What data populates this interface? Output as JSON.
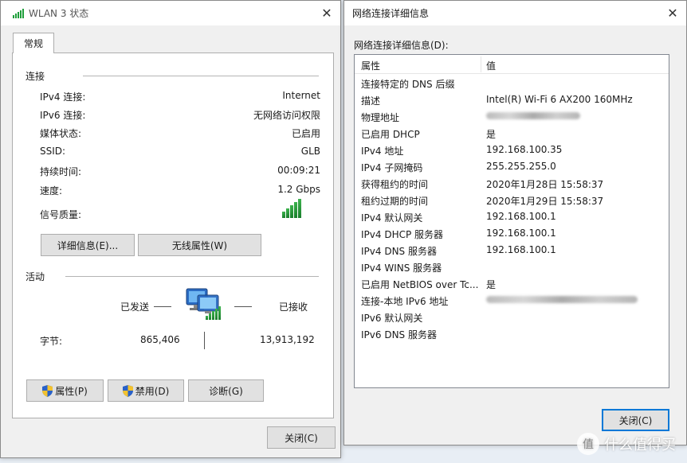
{
  "left": {
    "title": "WLAN 3 状态",
    "tab": "常规",
    "connection_group": "连接",
    "rows": [
      {
        "k": "IPv4 连接:",
        "v": "Internet"
      },
      {
        "k": "IPv6 连接:",
        "v": "无网络访问权限"
      },
      {
        "k": "媒体状态:",
        "v": "已启用"
      },
      {
        "k": "SSID:",
        "v": "GLB"
      },
      {
        "k": "持续时间:",
        "v": "00:09:21"
      },
      {
        "k": "速度:",
        "v": "1.2 Gbps"
      },
      {
        "k": "信号质量:",
        "v": ""
      }
    ],
    "signal_level": "5/5",
    "details_button": "详细信息(E)...",
    "wireless_props_button": "无线属性(W)",
    "activity_group": "活动",
    "sent_label": "已发送",
    "received_label": "已接收",
    "bytes_label": "字节:",
    "bytes_sent": "865,406",
    "bytes_received": "13,913,192",
    "properties_button": "属性(P)",
    "disable_button": "禁用(D)",
    "diagnose_button": "诊断(G)",
    "close_button": "关闭(C)"
  },
  "right": {
    "title": "网络连接详细信息",
    "list_label": "网络连接详细信息(D):",
    "col_property": "属性",
    "col_value": "值",
    "rows": [
      {
        "p": "连接特定的 DNS 后缀",
        "v": ""
      },
      {
        "p": "描述",
        "v": "Intel(R) Wi-Fi 6 AX200 160MHz"
      },
      {
        "p": "物理地址",
        "v": ""
      },
      {
        "p": "已启用 DHCP",
        "v": "是"
      },
      {
        "p": "IPv4 地址",
        "v": "192.168.100.35"
      },
      {
        "p": "IPv4 子网掩码",
        "v": "255.255.255.0"
      },
      {
        "p": "获得租约的时间",
        "v": "2020年1月28日 15:58:37"
      },
      {
        "p": "租约过期的时间",
        "v": "2020年1月29日 15:58:37"
      },
      {
        "p": "IPv4 默认网关",
        "v": "192.168.100.1"
      },
      {
        "p": "IPv4 DHCP 服务器",
        "v": "192.168.100.1"
      },
      {
        "p": "IPv4 DNS 服务器",
        "v": "192.168.100.1"
      },
      {
        "p": "IPv4 WINS 服务器",
        "v": ""
      },
      {
        "p": "已启用 NetBIOS over Tc...",
        "v": "是"
      },
      {
        "p": "连接-本地 IPv6 地址",
        "v": ""
      },
      {
        "p": "IPv6 默认网关",
        "v": ""
      },
      {
        "p": "IPv6 DNS 服务器",
        "v": ""
      }
    ],
    "close_button": "关闭(C)"
  },
  "watermark": "什么值得买",
  "colors": {
    "signal_green": "#1e9e3a",
    "accent": "#0078d7"
  }
}
